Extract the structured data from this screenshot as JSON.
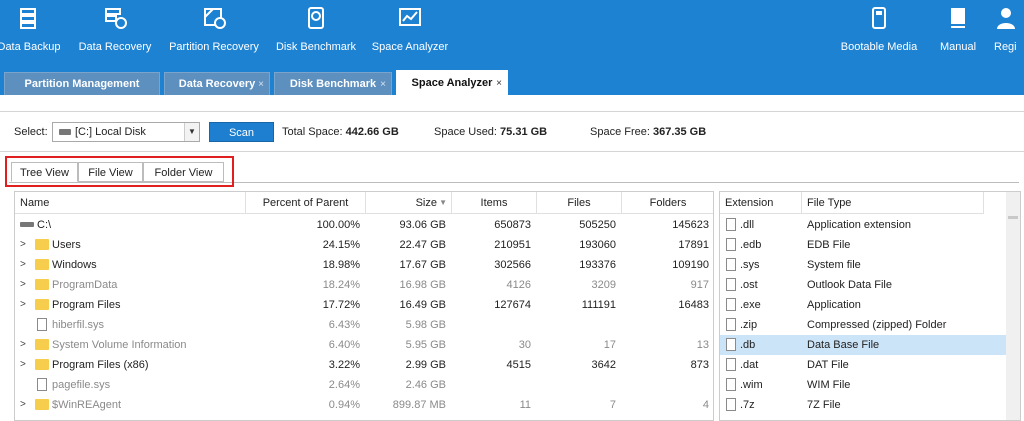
{
  "toolbar": {
    "items": [
      {
        "label": "Data Backup",
        "icon": "data-backup-icon"
      },
      {
        "label": "Data Recovery",
        "icon": "data-recovery-icon"
      },
      {
        "label": "Partition Recovery",
        "icon": "partition-recovery-icon"
      },
      {
        "label": "Disk Benchmark",
        "icon": "disk-benchmark-icon"
      },
      {
        "label": "Space Analyzer",
        "icon": "space-analyzer-icon"
      },
      {
        "label": "Bootable Media",
        "icon": "bootable-media-icon"
      },
      {
        "label": "Manual",
        "icon": "manual-icon"
      },
      {
        "label": "Regi",
        "icon": "register-icon"
      }
    ]
  },
  "tabs": [
    {
      "label": "Partition Management",
      "closable": false
    },
    {
      "label": "Data Recovery",
      "closable": true
    },
    {
      "label": "Disk Benchmark",
      "closable": true
    },
    {
      "label": "Space Analyzer",
      "closable": true,
      "active": true
    }
  ],
  "tab_close": "×",
  "select": {
    "label": "Select:",
    "value": "[C:] Local Disk",
    "scan_label": "Scan",
    "total_label": "Total Space:",
    "total_value": "442.66 GB",
    "used_label": "Space Used:",
    "used_value": "75.31 GB",
    "free_label": "Space Free:",
    "free_value": "367.35 GB"
  },
  "view_tabs": [
    "Tree View",
    "File View",
    "Folder View"
  ],
  "tree": {
    "columns": [
      "Name",
      "Percent of Parent",
      "Size",
      "Items",
      "Files",
      "Folders"
    ],
    "rows": [
      {
        "name": "C:\\",
        "pct": "100.00%",
        "size": "93.06 GB",
        "items": "650873",
        "files": "505250",
        "folders": "145623",
        "kind": "drive",
        "expand": false,
        "dim": false
      },
      {
        "name": "Users",
        "pct": "24.15%",
        "size": "22.47 GB",
        "items": "210951",
        "files": "193060",
        "folders": "17891",
        "kind": "folder",
        "expand": true,
        "dim": false
      },
      {
        "name": "Windows",
        "pct": "18.98%",
        "size": "17.67 GB",
        "items": "302566",
        "files": "193376",
        "folders": "109190",
        "kind": "folder",
        "expand": true,
        "dim": false
      },
      {
        "name": "ProgramData",
        "pct": "18.24%",
        "size": "16.98 GB",
        "items": "4126",
        "files": "3209",
        "folders": "917",
        "kind": "folder",
        "expand": true,
        "dim": true
      },
      {
        "name": "Program Files",
        "pct": "17.72%",
        "size": "16.49 GB",
        "items": "127674",
        "files": "111191",
        "folders": "16483",
        "kind": "folder",
        "expand": true,
        "dim": false
      },
      {
        "name": "hiberfil.sys",
        "pct": "6.43%",
        "size": "5.98 GB",
        "items": "",
        "files": "",
        "folders": "",
        "kind": "file",
        "expand": false,
        "dim": true
      },
      {
        "name": "System Volume Information",
        "pct": "6.40%",
        "size": "5.95 GB",
        "items": "30",
        "files": "17",
        "folders": "13",
        "kind": "folder",
        "expand": true,
        "dim": true
      },
      {
        "name": "Program Files (x86)",
        "pct": "3.22%",
        "size": "2.99 GB",
        "items": "4515",
        "files": "3642",
        "folders": "873",
        "kind": "folder",
        "expand": true,
        "dim": false
      },
      {
        "name": "pagefile.sys",
        "pct": "2.64%",
        "size": "2.46 GB",
        "items": "",
        "files": "",
        "folders": "",
        "kind": "file",
        "expand": false,
        "dim": true
      },
      {
        "name": "$WinREAgent",
        "pct": "0.94%",
        "size": "899.87 MB",
        "items": "11",
        "files": "7",
        "folders": "4",
        "kind": "folder",
        "expand": true,
        "dim": true
      }
    ]
  },
  "ext": {
    "columns": [
      "Extension",
      "File Type"
    ],
    "rows": [
      {
        "ext": ".dll",
        "type": "Application extension"
      },
      {
        "ext": ".edb",
        "type": "EDB File"
      },
      {
        "ext": ".sys",
        "type": "System file"
      },
      {
        "ext": ".ost",
        "type": "Outlook Data File"
      },
      {
        "ext": ".exe",
        "type": "Application"
      },
      {
        "ext": ".zip",
        "type": "Compressed (zipped) Folder"
      },
      {
        "ext": ".db",
        "type": "Data Base File",
        "selected": true
      },
      {
        "ext": ".dat",
        "type": "DAT File"
      },
      {
        "ext": ".wim",
        "type": "WIM File"
      },
      {
        "ext": ".7z",
        "type": "7Z File"
      }
    ]
  },
  "colors": {
    "toolbar": "#1e82d2",
    "tab": "#5d8fbf",
    "accent": "#1e7fd0",
    "highlight": "#e02020",
    "selected_row": "#cce4f7"
  }
}
